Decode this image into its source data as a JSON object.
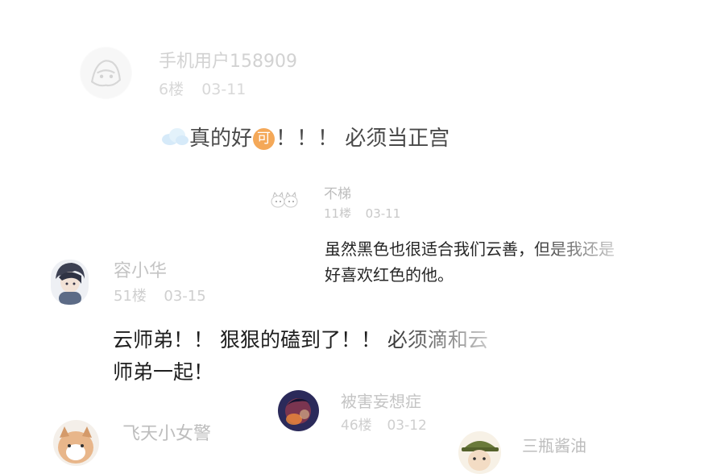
{
  "colors": {
    "name_faint": "#cfcfcf",
    "meta_faint": "#d6d6d6",
    "text_main": "#222222",
    "text_faded": "#9a9a9a",
    "badge_orange": "#f39a3c"
  },
  "comments": [
    {
      "username": "手机用户158909",
      "floor": "6楼",
      "date": "03-11",
      "avatar_icon": "line-art-avatar-icon",
      "emoji_icon": "cloud-emoji-icon",
      "text_part1": "真的好",
      "badge_text": "可",
      "text_part2": "！！！ 必须当正宫"
    },
    {
      "username": "不梯",
      "floor": "11楼",
      "date": "03-11",
      "avatar_icon": "cartoon-cats-avatar-icon",
      "lines": [
        "虽然黑色也很适合我们云善，但是我还是",
        "好喜欢红色的他。"
      ]
    },
    {
      "username": "容小华",
      "floor": "51楼",
      "date": "03-15",
      "avatar_icon": "anime-character-avatar-icon",
      "lines": [
        "云师弟！！ 狠狠的磕到了！！ 必须滴和云",
        "师弟一起！"
      ]
    },
    {
      "username": "被害妄想症",
      "floor": "46楼",
      "date": "03-12",
      "avatar_icon": "dark-portrait-avatar-icon"
    },
    {
      "username": "飞天小女警",
      "avatar_icon": "dog-avatar-icon"
    },
    {
      "username": "三瓶酱油",
      "avatar_icon": "hat-character-avatar-icon"
    }
  ]
}
